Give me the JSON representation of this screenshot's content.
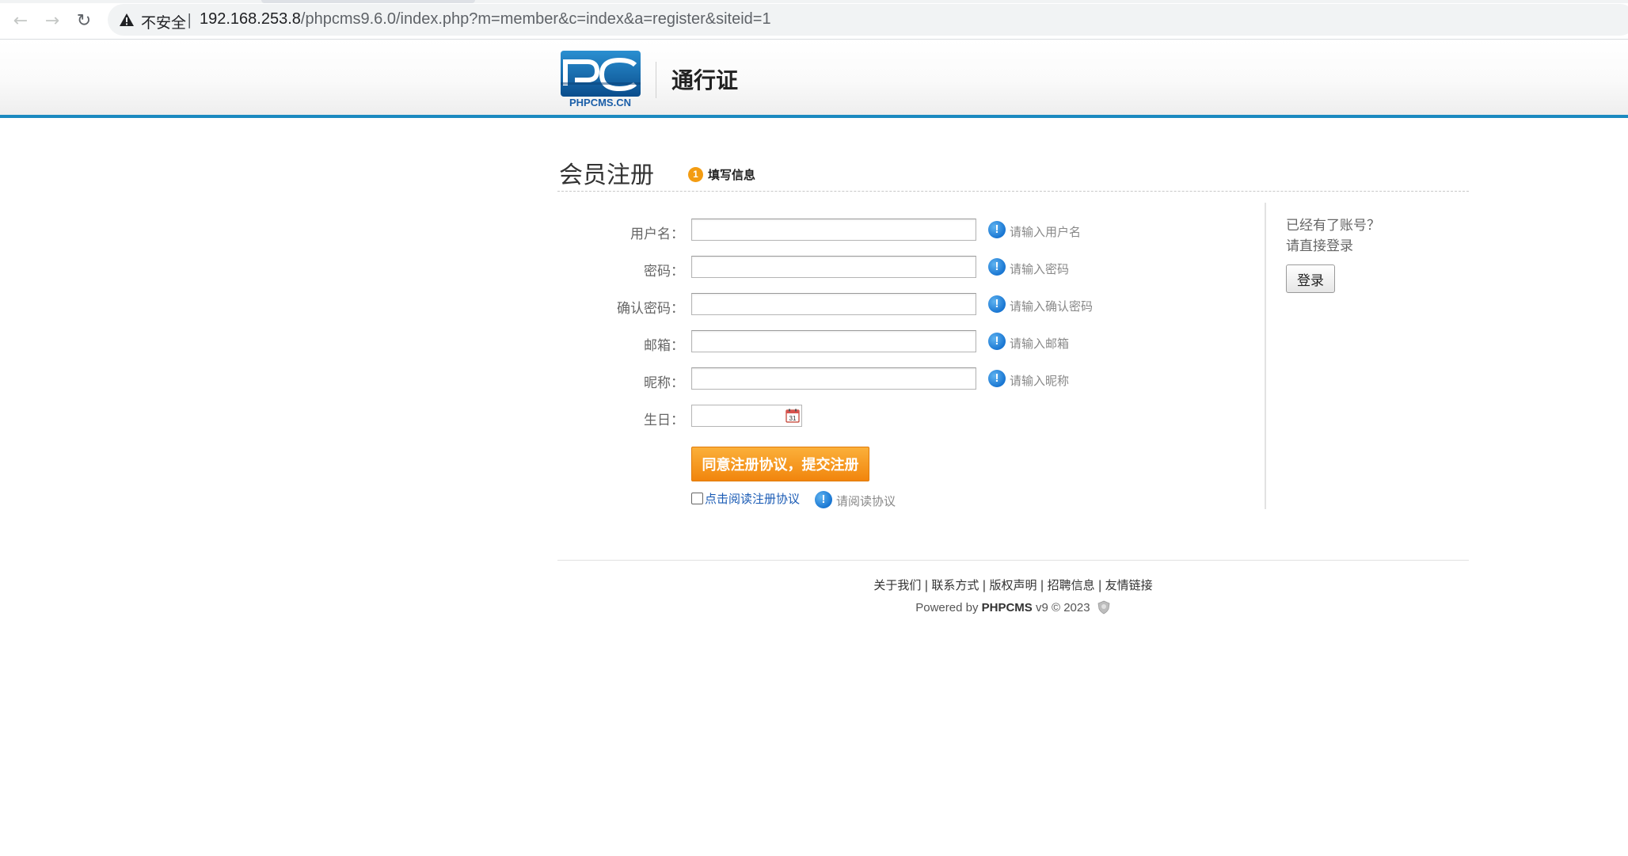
{
  "browser": {
    "security_label": "不安全",
    "url_host": "192.168.253.8",
    "url_path": "/phpcms9.6.0/index.php?m=member&c=index&a=register&siteid=1"
  },
  "header": {
    "logo_text": "PHPCMS.CN",
    "title": "通行证"
  },
  "page": {
    "title": "会员注册",
    "step_number": "1",
    "step_label": "填写信息"
  },
  "form": {
    "fields": [
      {
        "label": "用户名：",
        "value": "",
        "hint": "请输入用户名"
      },
      {
        "label": "密码：",
        "value": "",
        "hint": "请输入密码"
      },
      {
        "label": "确认密码：",
        "value": "",
        "hint": "请输入确认密码"
      },
      {
        "label": "邮箱：",
        "value": "",
        "hint": "请输入邮箱"
      },
      {
        "label": "昵称：",
        "value": "",
        "hint": "请输入昵称"
      }
    ],
    "birthday_label": "生日：",
    "birthday_value": "",
    "submit_label": "同意注册协议，提交注册",
    "agreement_link": "点击阅读注册协议",
    "agreement_hint": "请阅读协议"
  },
  "aside": {
    "line1": "已经有了账号？",
    "line2": "请直接登录",
    "login_label": "登录"
  },
  "footer": {
    "links": [
      "关于我们",
      "联系方式",
      "版权声明",
      "招聘信息",
      "友情链接"
    ],
    "powered_prefix": "Powered by",
    "powered_brand": "PHPCMS",
    "powered_suffix": "v9 © 2023"
  },
  "colors": {
    "accent_blue": "#1b8ac0",
    "submit_orange": "#f39c12",
    "hint_blue": "#1976d2",
    "link_blue": "#1a5bb5"
  }
}
